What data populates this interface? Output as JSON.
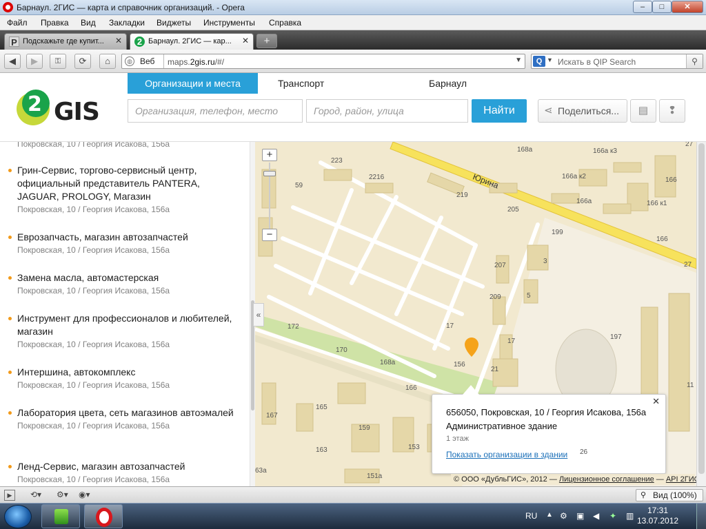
{
  "window": {
    "title": "Барнаул. 2ГИС — карта и справочник организаций. - Opera",
    "buttons": {
      "minimize": "–",
      "maximize": "□",
      "close": "✕"
    }
  },
  "menubar": [
    "Файл",
    "Правка",
    "Вид",
    "Закладки",
    "Виджеты",
    "Инструменты",
    "Справка"
  ],
  "tabs": [
    {
      "label": "Подскажьте где купит...",
      "icon": "P",
      "active": false
    },
    {
      "label": "Барнаул. 2ГИС — кар...",
      "icon": "2",
      "active": true
    }
  ],
  "newtab": "+",
  "addressbar": {
    "scheme_label": "Веб",
    "url_prefix": "maps.",
    "url_host": "2gis.ru",
    "url_path": "/#/",
    "search_placeholder": "Искать в QIP Search",
    "search_engine": "QIP"
  },
  "gis": {
    "logo_two": "2",
    "logo_text": "GIS",
    "nav": [
      "Организации и места",
      "Транспорт",
      "Барнаул"
    ],
    "org_placeholder": "Организация, телефон, место",
    "city_placeholder": "Город, район, улица",
    "find_label": "Найти",
    "share_label": "Поделиться...",
    "accent_color": "#29a0d8"
  },
  "results": [
    {
      "name": "",
      "address": "Покровская, 10 / Георгия Исакова, 156а",
      "cut_top": true
    },
    {
      "name": "Грин-Сервис, торгово-сервисный центр, официальный представитель PANTERA, JAGUAR, PROLOGY, Магазин",
      "address": "Покровская, 10 / Георгия Исакова, 156а"
    },
    {
      "name": "Еврозапчасть, магазин автозапчастей",
      "address": "Покровская, 10 / Георгия Исакова, 156а"
    },
    {
      "name": "Замена масла, автомастерская",
      "address": "Покровская, 10 / Георгия Исакова, 156а"
    },
    {
      "name": "Инструмент для профессионалов и любителей, магазин",
      "address": "Покровская, 10 / Георгия Исакова, 156а"
    },
    {
      "name": "Интершина, автокомплекс",
      "address": "Покровская, 10 / Георгия Исакова, 156а"
    },
    {
      "name": "Лаборатория цвета, сеть магазинов автоэмалей",
      "address": "Покровская, 10 / Георгия Исакова, 156а"
    },
    {
      "name": "Ленд-Сервис, магазин автозапчастей",
      "address": "Покровская, 10 / Георгия Исакова, 156а"
    }
  ],
  "map": {
    "street_label": "Юрина",
    "house_numbers": [
      "223",
      "2216",
      "59",
      "219",
      "205",
      "199",
      "3",
      "207",
      "209",
      "5",
      "17",
      "17",
      "197",
      "172",
      "170",
      "168а",
      "156",
      "21",
      "166",
      "167",
      "165",
      "159",
      "163",
      "153",
      "151а",
      "63а",
      "168а",
      "166а к3",
      "166а к2",
      "166а",
      "166",
      "166 к1",
      "166",
      "27",
      "27",
      "11"
    ],
    "popup": {
      "address": "656050, Покровская, 10 / Георгия Исакова, 156а",
      "kind": "Административное здание",
      "floors": "1 этаж",
      "link": "Показать организации в здании",
      "count": "26",
      "close": "✕"
    },
    "copyright": {
      "owner": "© ООО «ДубльГИС», 2012",
      "license": "Лицензионное соглашение",
      "api": "API 2ГИС"
    }
  },
  "statusbar": {
    "zoom_label": "Вид (100%)"
  },
  "taskbar": {
    "lang": "RU",
    "time": "17:31",
    "date": "13.07.2012"
  }
}
